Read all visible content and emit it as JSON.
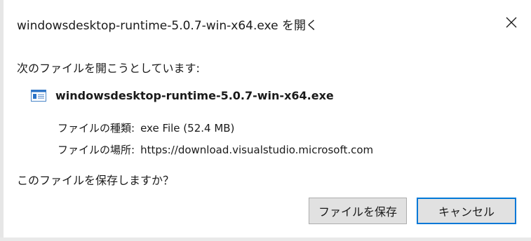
{
  "dialog": {
    "title": "windowsdesktop-runtime-5.0.7-win-x64.exe を開く",
    "close_icon": "close-icon",
    "prompt": "次のファイルを開こうとしています:",
    "file": {
      "icon": "application-window-icon",
      "name": "windowsdesktop-runtime-5.0.7-win-x64.exe"
    },
    "type_label": "ファイルの種類:",
    "type_value": "exe File (52.4 MB)",
    "from_label": "ファイルの場所:",
    "from_value": "https://download.visualstudio.microsoft.com",
    "question": "このファイルを保存しますか？",
    "buttons": {
      "save_label": "ファイルを保存",
      "cancel_label": "キャンセル"
    }
  },
  "colors": {
    "button_face": "#e1e1e1",
    "button_border": "#adadad",
    "focus_border": "#0078d7",
    "icon_blue": "#2b73c6"
  }
}
